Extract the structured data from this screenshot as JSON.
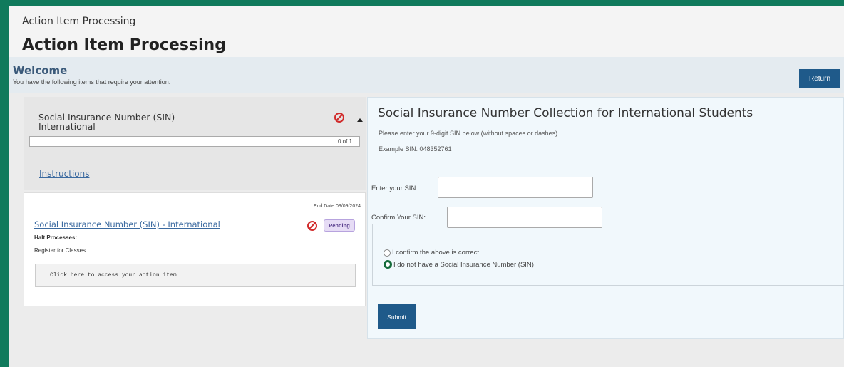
{
  "breadcrumb": "Action Item Processing",
  "page_title": "Action Item Processing",
  "banner": {
    "title": "Welcome",
    "subtitle": "You have the following items that require your attention.",
    "return_label": "Return"
  },
  "item_panel": {
    "header_title": "Social Insurance Number (SIN) - International",
    "progress_text": "0 of 1",
    "progress_fraction": 0,
    "instructions_link": "Instructions",
    "end_date": "End Date:09/09/2024",
    "item_link": "Social Insurance Number (SIN) - International",
    "status_badge": "Pending",
    "halt_label": "Halt Processes:",
    "halt_value": "Register for Classes",
    "access_button": "Click here to access your action item"
  },
  "form": {
    "title": "Social Insurance Number Collection for International Students",
    "hint": "Please enter your 9-digit SIN below (without spaces or dashes)",
    "example": "Example SIN: 048352761",
    "sin_label": "Enter your SIN:",
    "sin_value": "",
    "confirm_label": "Confirm Your SIN:",
    "confirm_value": "",
    "radio_options": [
      {
        "label": "I confirm the above is correct",
        "checked": false
      },
      {
        "label": "I do not have a Social Insurance Number (SIN)",
        "checked": true
      }
    ],
    "submit_label": "Submit"
  },
  "colors": {
    "outer_background": "#107a5c",
    "primary_button": "#1f5a8a",
    "blocked_icon": "#d12b2b",
    "pending_badge": "#e6dcf5",
    "link": "#3b6aa0"
  },
  "icons": {
    "blocked": "no-entry-icon",
    "collapse": "caret-up-icon"
  }
}
